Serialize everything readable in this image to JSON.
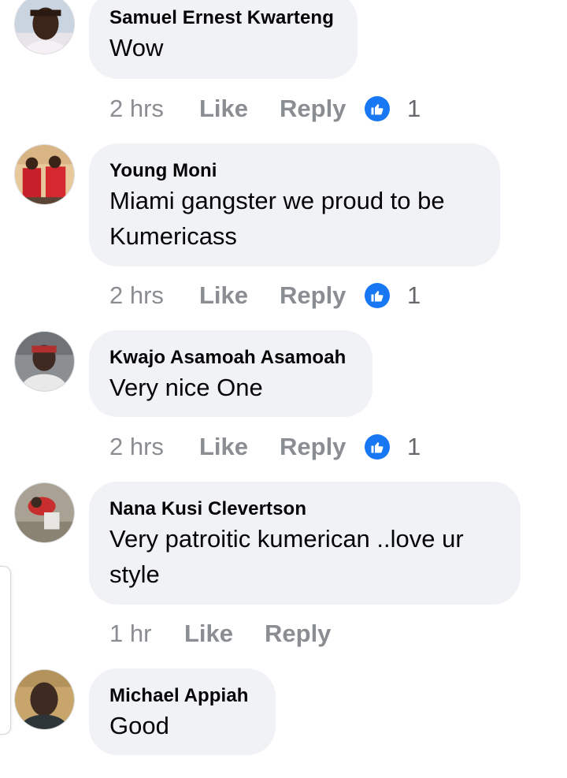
{
  "colors": {
    "bubble": "#f0f2f5",
    "meta": "#8a8d91",
    "like_blue": "#1877f2"
  },
  "icons": {
    "reaction": "thumbs-up-icon"
  },
  "comments": [
    {
      "author": "Samuel Ernest Kwarteng",
      "text": "Wow",
      "time": "2 hrs",
      "like_label": "Like",
      "reply_label": "Reply",
      "reactions": "1"
    },
    {
      "author": "Young Moni",
      "text": "Miami gangster we proud to be Kumericass",
      "time": "2 hrs",
      "like_label": "Like",
      "reply_label": "Reply",
      "reactions": "1"
    },
    {
      "author": "Kwajo Asamoah Asamoah",
      "text": "Very nice One",
      "time": "2 hrs",
      "like_label": "Like",
      "reply_label": "Reply",
      "reactions": "1"
    },
    {
      "author": "Nana Kusi Clevertson",
      "text": "Very patroitic kumerican ..love ur style",
      "time": "1 hr",
      "like_label": "Like",
      "reply_label": "Reply"
    },
    {
      "author": "Michael Appiah",
      "text": "Good",
      "time": "",
      "like_label": "",
      "reply_label": ""
    }
  ]
}
